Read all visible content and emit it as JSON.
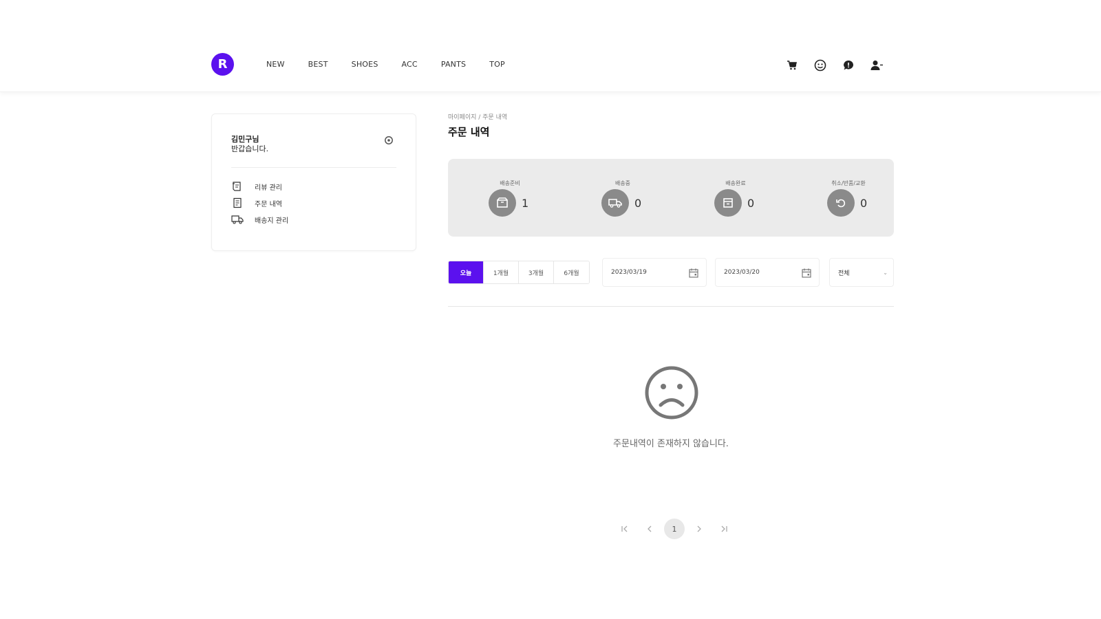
{
  "header": {
    "logo_text": "R",
    "brand_color": "#5b11ee",
    "nav": [
      "NEW",
      "BEST",
      "SHOES",
      "ACC",
      "PANTS",
      "TOP"
    ],
    "icons": [
      "cart-icon",
      "face-icon",
      "chat-icon",
      "user-icon"
    ]
  },
  "sidebar": {
    "name": "김민구님",
    "greeting": "반갑습니다.",
    "menu": [
      {
        "label": "리뷰 관리",
        "icon": "review-icon"
      },
      {
        "label": "주문 내역",
        "icon": "receipt-icon"
      },
      {
        "label": "배송지 관리",
        "icon": "truck-icon"
      }
    ]
  },
  "main": {
    "breadcrumb": "마이페이지 / 주문 내역",
    "title": "주문 내역",
    "statuses": [
      {
        "label": "배송준비",
        "count": "1",
        "icon": "box-icon"
      },
      {
        "label": "배송중",
        "count": "0",
        "icon": "delivery-icon"
      },
      {
        "label": "배송완료",
        "count": "0",
        "icon": "package-check-icon"
      },
      {
        "label": "취소/반품/교환",
        "count": "0",
        "icon": "return-icon"
      }
    ],
    "periods": [
      "오늘",
      "1개월",
      "3개월",
      "6개월"
    ],
    "active_period": "오늘",
    "start_date": "2023/03/19",
    "end_date": "2023/03/20",
    "select_value": "전체",
    "empty_message": "주문내역이 존재하지 않습니다."
  },
  "pagination": {
    "current": "1"
  }
}
